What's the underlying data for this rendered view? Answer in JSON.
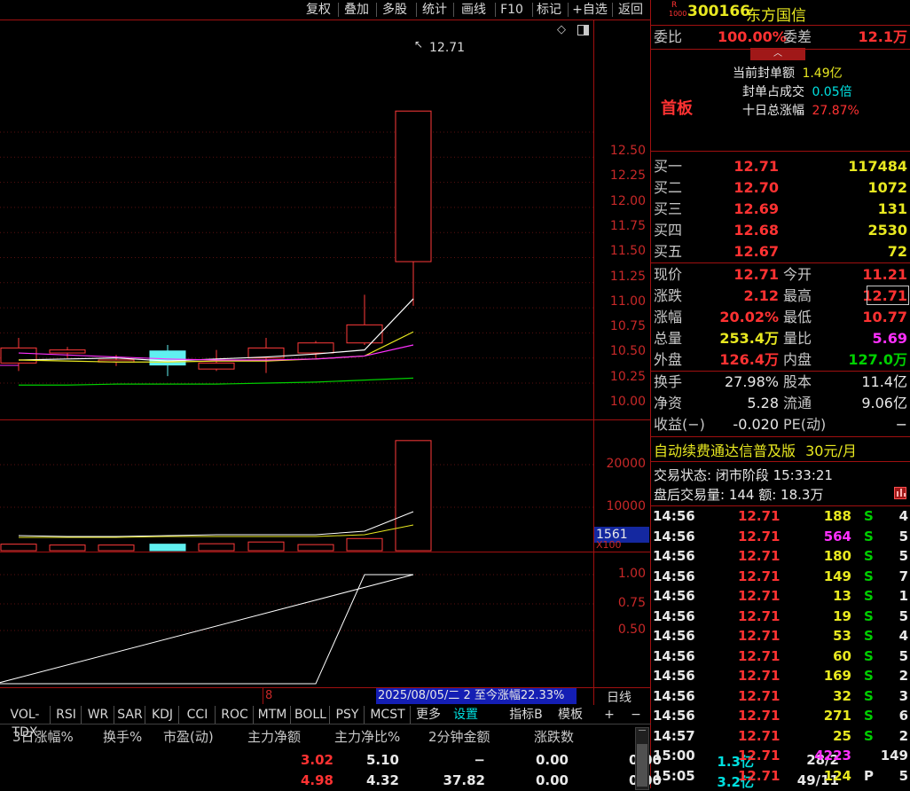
{
  "toolbar": {
    "buttons": [
      "复权",
      "叠加",
      "多股",
      "统计",
      "画线",
      "F10",
      "标记",
      "+自选",
      "返回"
    ]
  },
  "chart_data": {
    "type": "candlestick",
    "price_axis": [
      "12.50",
      "12.25",
      "12.00",
      "11.75",
      "11.50",
      "11.25",
      "11.00",
      "10.75",
      "10.50",
      "10.25",
      "10.00"
    ],
    "last_price_label": "12.71",
    "volume_axis": [
      "20000",
      "10000"
    ],
    "volume_marker": "1561",
    "volume_unit": "X100",
    "indicator_axis": [
      "1.00",
      "0.75",
      "0.50"
    ],
    "candles": [
      {
        "open": 10.2,
        "close": 10.35,
        "high": 10.45,
        "low": 10.12,
        "color": "red"
      },
      {
        "open": 10.3,
        "close": 10.33,
        "high": 10.36,
        "low": 10.25,
        "color": "red"
      },
      {
        "open": 10.21,
        "close": 10.23,
        "high": 10.28,
        "low": 10.17,
        "color": "red"
      },
      {
        "open": 10.32,
        "close": 10.18,
        "high": 10.38,
        "low": 10.07,
        "color": "cyan"
      },
      {
        "open": 10.14,
        "close": 10.2,
        "high": 10.33,
        "low": 10.12,
        "color": "red"
      },
      {
        "open": 10.25,
        "close": 10.35,
        "high": 10.45,
        "low": 10.1,
        "color": "red"
      },
      {
        "open": 10.3,
        "close": 10.4,
        "high": 10.42,
        "low": 10.25,
        "color": "red"
      },
      {
        "open": 10.4,
        "close": 10.58,
        "high": 10.88,
        "low": 10.38,
        "color": "red"
      },
      {
        "open": 11.21,
        "close": 12.71,
        "high": 12.71,
        "low": 10.77,
        "color": "red"
      }
    ],
    "volumes": [
      {
        "value": 1500,
        "color": "red"
      },
      {
        "value": 1300,
        "color": "red"
      },
      {
        "value": 1300,
        "color": "red"
      },
      {
        "value": 1500,
        "color": "cyan"
      },
      {
        "value": 1600,
        "color": "red"
      },
      {
        "value": 2000,
        "color": "red"
      },
      {
        "value": 1400,
        "color": "red"
      },
      {
        "value": 2800,
        "color": "red"
      },
      {
        "value": 25340,
        "color": "red"
      }
    ],
    "indicator": [
      0,
      0,
      0,
      0,
      0,
      0,
      0,
      1,
      1
    ]
  },
  "status_bar": {
    "marker": "8",
    "info": "2025/08/05/二 2 至今涨幅22.33%",
    "period": "日线"
  },
  "indicator_tabs": [
    "VOL-TDX",
    "RSI",
    "WR",
    "SAR",
    "KDJ",
    "CCI",
    "ROC",
    "MTM",
    "BOLL",
    "PSY",
    "MCST",
    "更多",
    "设置",
    "指标B",
    "模板",
    "+",
    "−"
  ],
  "bottom_table": {
    "headers": [
      "3日涨幅%",
      "换手%",
      "市盈(动)",
      "主力净额",
      "主力净比%",
      "2分钟金额",
      "涨跌数"
    ],
    "rows": [
      [
        "3.02",
        "5.10",
        "−",
        "0.00",
        "0.00",
        "1.3亿",
        "28/2"
      ],
      [
        "4.98",
        "4.32",
        "37.82",
        "0.00",
        "0.00",
        "3.2亿",
        "49/11"
      ]
    ]
  },
  "stock": {
    "badge": "R",
    "badge2": "1000",
    "code": "300166",
    "name": "东方国信",
    "weibi_label": "委比",
    "weibi_value": "100.00%",
    "weicha_label": "委差",
    "weicha_value": "12.1万",
    "board": "首板",
    "seal_amount_label": "当前封单额",
    "seal_amount": "1.49亿",
    "seal_ratio_label": "封单占成交",
    "seal_ratio": "0.05倍",
    "ten_day_label": "十日总涨幅",
    "ten_day": "27.87%"
  },
  "order_book": [
    {
      "label": "买一",
      "price": "12.71",
      "vol": "117484"
    },
    {
      "label": "买二",
      "price": "12.70",
      "vol": "1072"
    },
    {
      "label": "买三",
      "price": "12.69",
      "vol": "131"
    },
    {
      "label": "买四",
      "price": "12.68",
      "vol": "2530"
    },
    {
      "label": "买五",
      "price": "12.67",
      "vol": "72"
    }
  ],
  "quote": [
    {
      "l1": "现价",
      "v1": "12.71",
      "l2": "今开",
      "v2": "11.21"
    },
    {
      "l1": "涨跌",
      "v1": "2.12",
      "l2": "最高",
      "v2": "12.71"
    },
    {
      "l1": "涨幅",
      "v1": "20.02%",
      "l2": "最低",
      "v2": "10.77"
    },
    {
      "l1": "总量",
      "v1": "253.4万",
      "l2": "量比",
      "v2": "5.69"
    },
    {
      "l1": "外盘",
      "v1": "126.4万",
      "l2": "内盘",
      "v2": "127.0万"
    }
  ],
  "fundamentals": [
    {
      "l1": "换手",
      "v1": "27.98%",
      "l2": "股本",
      "v2": "11.4亿"
    },
    {
      "l1": "净资",
      "v1": "5.28",
      "l2": "流通",
      "v2": "9.06亿"
    },
    {
      "l1": "收益(−)",
      "v1": "-0.020",
      "l2": "PE(动)",
      "v2": "−"
    }
  ],
  "promo": {
    "text": "自动续费通达信普及版",
    "price": "30元/月"
  },
  "trade_state": {
    "line1": "交易状态: 闭市阶段 15:33:21",
    "line2": "盘后交易量: 144  额: 18.3万"
  },
  "ticks": [
    {
      "t": "14:56",
      "p": "12.71",
      "v": "188",
      "d": "S",
      "n": "4"
    },
    {
      "t": "14:56",
      "p": "12.71",
      "v": "564",
      "d": "S",
      "n": "5"
    },
    {
      "t": "14:56",
      "p": "12.71",
      "v": "180",
      "d": "S",
      "n": "5"
    },
    {
      "t": "14:56",
      "p": "12.71",
      "v": "149",
      "d": "S",
      "n": "7"
    },
    {
      "t": "14:56",
      "p": "12.71",
      "v": "13",
      "d": "S",
      "n": "1"
    },
    {
      "t": "14:56",
      "p": "12.71",
      "v": "19",
      "d": "S",
      "n": "5"
    },
    {
      "t": "14:56",
      "p": "12.71",
      "v": "53",
      "d": "S",
      "n": "4"
    },
    {
      "t": "14:56",
      "p": "12.71",
      "v": "60",
      "d": "S",
      "n": "5"
    },
    {
      "t": "14:56",
      "p": "12.71",
      "v": "169",
      "d": "S",
      "n": "2"
    },
    {
      "t": "14:56",
      "p": "12.71",
      "v": "32",
      "d": "S",
      "n": "3"
    },
    {
      "t": "14:56",
      "p": "12.71",
      "v": "271",
      "d": "S",
      "n": "6"
    },
    {
      "t": "14:57",
      "p": "12.71",
      "v": "25",
      "d": "S",
      "n": "2"
    },
    {
      "t": "15:00",
      "p": "12.71",
      "v": "4223",
      "d": "",
      "n": "149"
    },
    {
      "t": "15:05",
      "p": "12.71",
      "v": "124",
      "d": "P",
      "n": "5"
    }
  ]
}
